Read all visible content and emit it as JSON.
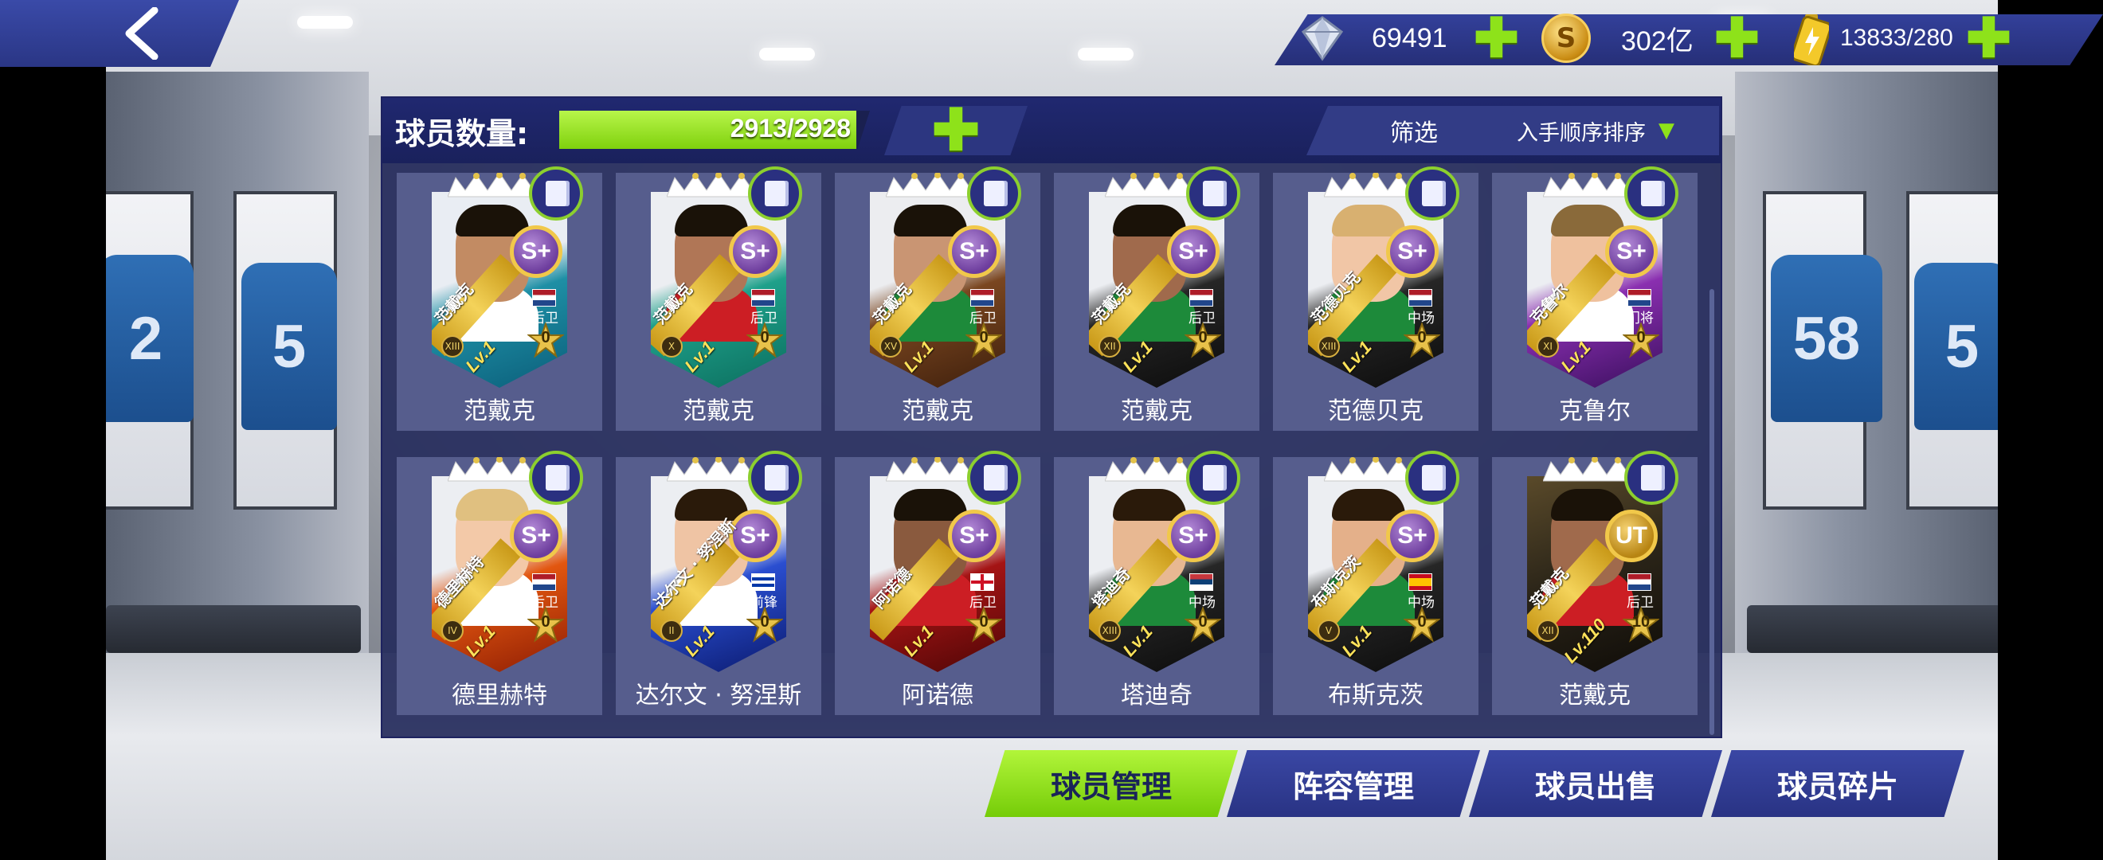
{
  "header": {
    "back_icon": "chevron-left-icon"
  },
  "resources": {
    "gems": "69491",
    "coins": "302亿",
    "coin_symbol": "S",
    "energy": "13833/280",
    "add_symbol": "✚",
    "accent_green": "#8ee21a"
  },
  "panel": {
    "count_label": "球员数量:",
    "count_value": "2913/2928",
    "fill_fraction": 0.995,
    "add_symbol": "✚",
    "filter_label": "筛选",
    "sort_label": "入手顺序排序",
    "sort_arrow": "▼"
  },
  "players": [
    {
      "name": "范戴克",
      "card_name": "范戴克",
      "grade": "S+",
      "position": "后卫",
      "level": "Lv.1",
      "stars": "0",
      "roman": "XIII",
      "flag": "nl",
      "bg": "teal"
    },
    {
      "name": "范戴克",
      "card_name": "范戴克",
      "grade": "S+",
      "position": "后卫",
      "level": "Lv.1",
      "stars": "0",
      "roman": "X",
      "flag": "nl",
      "bg": "green"
    },
    {
      "name": "范戴克",
      "card_name": "范戴克",
      "grade": "S+",
      "position": "后卫",
      "level": "Lv.1",
      "stars": "0",
      "roman": "XV",
      "flag": "nl",
      "bg": "brown"
    },
    {
      "name": "范戴克",
      "card_name": "范戴克",
      "grade": "S+",
      "position": "后卫",
      "level": "Lv.1",
      "stars": "0",
      "roman": "XII",
      "flag": "nl",
      "bg": "black"
    },
    {
      "name": "范德贝克",
      "card_name": "范德贝克",
      "grade": "S+",
      "position": "中场",
      "level": "Lv.1",
      "stars": "0",
      "roman": "XIII",
      "flag": "nl",
      "bg": "black"
    },
    {
      "name": "克鲁尔",
      "card_name": "克鲁尔",
      "grade": "S+",
      "position": "门将",
      "level": "Lv.1",
      "stars": "0",
      "roman": "XI",
      "flag": "nl",
      "bg": "purple"
    },
    {
      "name": "德里赫特",
      "card_name": "德里赫特",
      "grade": "S+",
      "position": "后卫",
      "level": "Lv.1",
      "stars": "0",
      "roman": "IV",
      "flag": "nl",
      "bg": "fire"
    },
    {
      "name": "达尔文 · 努涅斯",
      "card_name": "达尔文 · 努涅斯",
      "grade": "S+",
      "position": "前锋",
      "level": "Lv.1",
      "stars": "0",
      "roman": "II",
      "flag": "uy",
      "bg": "blue"
    },
    {
      "name": "阿诺德",
      "card_name": "阿诺德",
      "grade": "S+",
      "position": "后卫",
      "level": "Lv.1",
      "stars": "0",
      "roman": "",
      "flag": "en",
      "bg": "red"
    },
    {
      "name": "塔迪奇",
      "card_name": "塔迪奇",
      "grade": "S+",
      "position": "中场",
      "level": "Lv.1",
      "stars": "0",
      "roman": "XIII",
      "flag": "rs",
      "bg": "black"
    },
    {
      "name": "布斯克茨",
      "card_name": "布斯克茨",
      "grade": "S+",
      "position": "中场",
      "level": "Lv.1",
      "stars": "0",
      "roman": "V",
      "flag": "es",
      "bg": "black"
    },
    {
      "name": "范戴克",
      "card_name": "范戴克",
      "grade": "UT",
      "position": "后卫",
      "level": "Lv.110",
      "stars": "10",
      "roman": "XII",
      "flag": "nl",
      "bg": "dark"
    }
  ],
  "tabs": [
    {
      "label": "球员管理",
      "active": true
    },
    {
      "label": "阵容管理",
      "active": false
    },
    {
      "label": "球员出售",
      "active": false
    },
    {
      "label": "球员碎片",
      "active": false
    }
  ],
  "background": {
    "jersey_numbers": [
      "2",
      "5",
      "58",
      "5"
    ]
  }
}
